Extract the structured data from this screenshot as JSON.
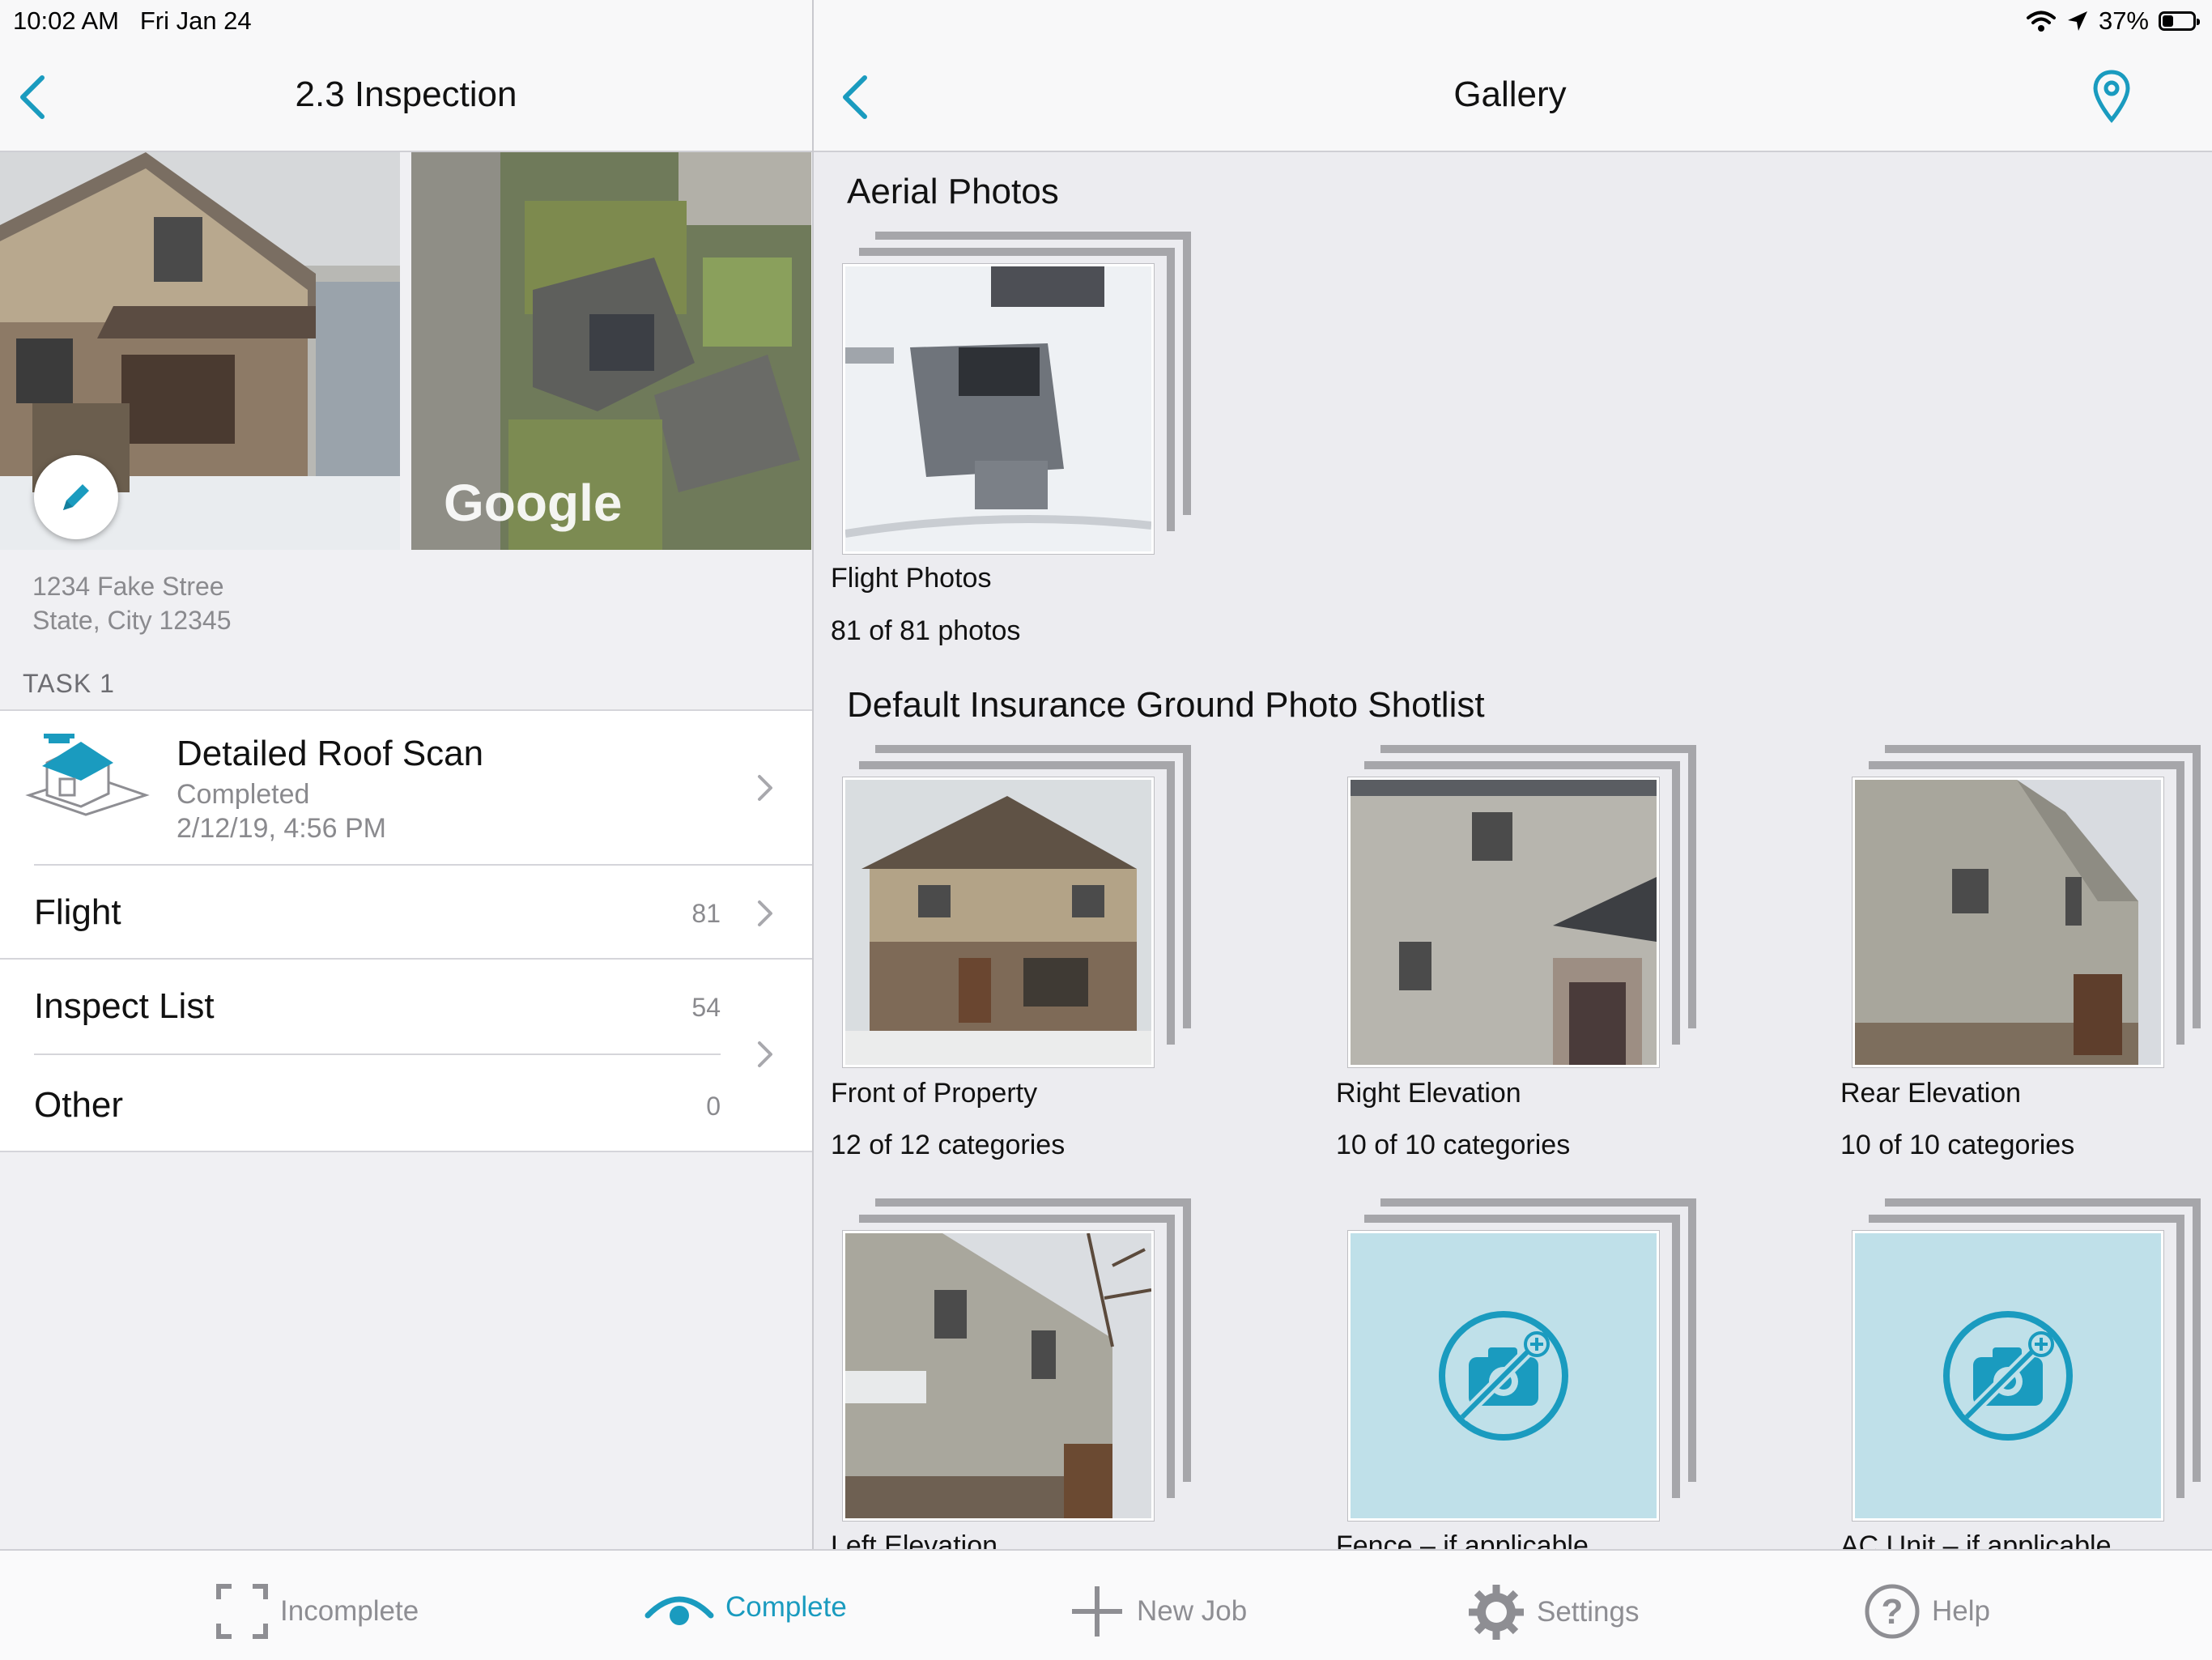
{
  "status_bar": {
    "time": "10:02 AM",
    "date": "Fri Jan 24",
    "battery": "37%",
    "battery_level": 0.37
  },
  "left": {
    "title": "2.3 Inspection",
    "photos": [
      "house-front-photo",
      "satellite-photo"
    ],
    "map_watermark": "Google",
    "address_line1": "1234 Fake Stree",
    "address_line2": "State, City 12345",
    "task_label": "TASK 1",
    "task": {
      "title": "Detailed Roof Scan",
      "status": "Completed",
      "timestamp": "2/12/19, 4:56 PM"
    },
    "rows": [
      {
        "label": "Flight",
        "count": "81"
      },
      {
        "label": "Inspect List",
        "count": "54"
      },
      {
        "label": "Other",
        "count": "0"
      }
    ]
  },
  "right": {
    "title": "Gallery",
    "aerial_section": "Aerial Photos",
    "aerial_tile": {
      "name": "Flight Photos",
      "count": "81 of 81 photos"
    },
    "ground_section": "Default Insurance Ground Photo Shotlist",
    "ground_tiles": [
      {
        "name": "Front of Property",
        "count": "12 of 12 categories",
        "has_photo": true
      },
      {
        "name": "Right Elevation",
        "count": "10 of 10 categories",
        "has_photo": true
      },
      {
        "name": "Rear Elevation",
        "count": "10 of 10 categories",
        "has_photo": true
      },
      {
        "name": "Left Elevation",
        "count": "",
        "has_photo": true
      },
      {
        "name": "Fence – if applicable",
        "count": "",
        "has_photo": false
      },
      {
        "name": "AC Unit – if applicable",
        "count": "",
        "has_photo": false
      }
    ]
  },
  "tabs": [
    {
      "label": "Incomplete",
      "icon": "viewfinder-icon",
      "active": false
    },
    {
      "label": "Complete",
      "icon": "eye-icon",
      "active": true
    },
    {
      "label": "New Job",
      "icon": "plus-icon",
      "active": false
    },
    {
      "label": "Settings",
      "icon": "gear-icon",
      "active": false
    },
    {
      "label": "Help",
      "icon": "help-icon",
      "active": false
    }
  ],
  "colors": {
    "accent": "#1a9bbf",
    "no_photo_bg": "#bfe0e9"
  }
}
